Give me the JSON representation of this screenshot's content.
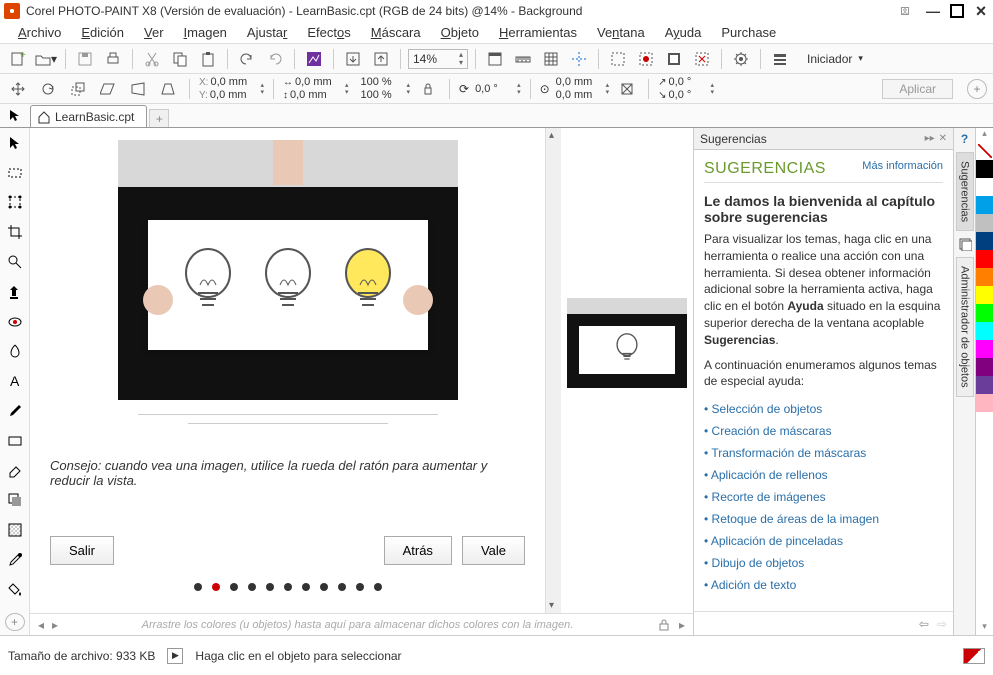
{
  "titlebar": {
    "app_title": "Corel PHOTO-PAINT X8 (Versión de evaluación) - LearnBasic.cpt (RGB de 24 bits) @14% - Background"
  },
  "menubar": {
    "items": [
      "Archivo",
      "Edición",
      "Ver",
      "Imagen",
      "Ajustar",
      "Efectos",
      "Máscara",
      "Objeto",
      "Herramientas",
      "Ventana",
      "Ayuda",
      "Purchase"
    ]
  },
  "toolbar1": {
    "zoom": "14%",
    "launcher": "Iniciador"
  },
  "toolbar2": {
    "x": "0,0 mm",
    "y": "0,0 mm",
    "w": "0,0 mm",
    "h": "0,0 mm",
    "sx": "100 %",
    "sy": "100 %",
    "angle": "0,0 °",
    "cx": "0,0 mm",
    "cy": "0,0 mm",
    "skew": "0,0 °",
    "skew2": "0,0 °",
    "apply": "Aplicar"
  },
  "tabs": {
    "doc": "LearnBasic.cpt"
  },
  "tutorial": {
    "tip": "Consejo: cuando vea una imagen, utilice la rueda del ratón para aumentar y reducir la vista.",
    "exit": "Salir",
    "back": "Atrás",
    "ok": "Vale",
    "dots_total": 11,
    "active_dot": 1
  },
  "color_tray_hint": "Arrastre los colores (u objetos) hasta aquí para almacenar dichos colores con la imagen.",
  "hints_panel": {
    "header": "Sugerencias",
    "title": "SUGERENCIAS",
    "more_info": "Más información",
    "h2": "Le damos la bienvenida al capítulo sobre sugerencias",
    "p1_a": "Para visualizar los temas, haga clic en una herramienta o realice una acción con una herramienta. Si desea obtener información adicional sobre la herramienta activa, haga clic en el botón ",
    "p1_bold": "Ayuda",
    "p1_b": " situado en la esquina superior derecha de la ventana acoplable ",
    "p1_bold2": "Sugerencias",
    "p1_c": ".",
    "p2": "A continuación enumeramos algunos temas de especial ayuda:",
    "links": [
      "Selección de objetos",
      "Creación de máscaras",
      "Transformación de máscaras",
      "Aplicación de rellenos",
      "Recorte de imágenes",
      "Retoque de áreas de la imagen",
      "Aplicación de pinceladas",
      "Dibujo de objetos",
      "Adición de texto"
    ]
  },
  "docks": {
    "tab1": "Sugerencias",
    "tab2": "Administrador de objetos"
  },
  "colors": [
    "#000000",
    "#ffffff",
    "#00a0e9",
    "#c0c0c0",
    "#003f7f",
    "#ff0000",
    "#ff8000",
    "#ffff00",
    "#00ff00",
    "#00ffff",
    "#ff00ff",
    "#800080",
    "#6a3d9a",
    "#ffb6c1"
  ],
  "statusbar": {
    "filesize": "Tamaño de archivo: 933 KB",
    "hint": "Haga clic en el objeto para seleccionar"
  }
}
